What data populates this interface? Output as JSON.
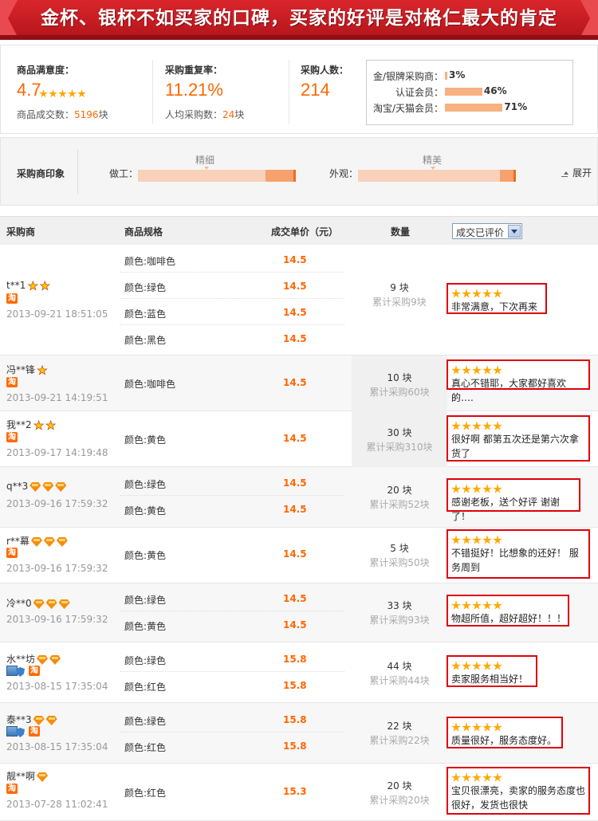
{
  "banner": {
    "title": "金杯、银杯不如买家的口碑，买家的好评是对格仁最大的肯定"
  },
  "summary": {
    "satisfaction": {
      "label": "商品满意度：",
      "value": "4.7",
      "sub_label": "商品成交数：",
      "sub_value": "5196",
      "sub_unit": "块"
    },
    "repurchase": {
      "label": "采购重复率：",
      "value": "11.21%",
      "sub_label": "人均采购数：",
      "sub_value": "24",
      "sub_unit": "块"
    },
    "buyers": {
      "label": "采购人数：",
      "value": "214"
    },
    "breakdown": [
      {
        "label": "金/银牌采购商：",
        "percent": 3,
        "text": "3%"
      },
      {
        "label": "认证会员：",
        "percent": 46,
        "text": "46%"
      },
      {
        "label": "淘宝/天猫会员：",
        "percent": 71,
        "text": "71%"
      }
    ]
  },
  "impression": {
    "label": "采购商印象",
    "items": [
      {
        "key": "做工：",
        "tag": "精细"
      },
      {
        "key": "外观：",
        "tag": "精美"
      }
    ],
    "expand": "展开"
  },
  "table": {
    "headers": {
      "buyer": "采购商",
      "spec": "商品规格",
      "price": "成交单价（元）",
      "qty": "数量"
    },
    "filter": {
      "selected": "成交已评价"
    },
    "rows": [
      {
        "buyer": "t**1",
        "date": "2013-09-21 18:51:05",
        "qty": "9 块",
        "cum": "累计采购9块",
        "review": "非常满意，下次再来",
        "specs": [
          {
            "spec": "颜色:咖啡色",
            "price": "14.5"
          },
          {
            "spec": "颜色:绿色",
            "price": "14.5"
          },
          {
            "spec": "颜色:蓝色",
            "price": "14.5"
          },
          {
            "spec": "颜色:黑色",
            "price": "14.5"
          }
        ]
      },
      {
        "buyer": "冯**锋",
        "date": "2013-09-21 14:19:51",
        "qty": "10 块",
        "cum": "累计采购60块",
        "review": "真心不错耶，大家都好喜欢的….",
        "specs": [
          {
            "spec": "颜色:咖啡色",
            "price": "14.5"
          }
        ]
      },
      {
        "buyer": "我**2",
        "date": "2013-09-17 14:19:48",
        "qty": "30 块",
        "cum": "累计采购310块",
        "review": "很好啊 都第五次还是第六次拿货了",
        "specs": [
          {
            "spec": "颜色:黄色",
            "price": "14.5"
          }
        ]
      },
      {
        "buyer": "q**3",
        "date": "2013-09-16 17:59:32",
        "qty": "20 块",
        "cum": "累计采购52块",
        "review": "感谢老板，送个好评 谢谢了！",
        "specs": [
          {
            "spec": "颜色:绿色",
            "price": "14.5"
          },
          {
            "spec": "颜色:黄色",
            "price": "14.5"
          }
        ]
      },
      {
        "buyer": "r**幕",
        "date": "2013-09-16 17:59:32",
        "qty": "5 块",
        "cum": "累计采购50块",
        "review": "不错挺好！比想象的还好！ 服务周到",
        "specs": [
          {
            "spec": "颜色:黄色",
            "price": "14.5"
          }
        ]
      },
      {
        "buyer": "冷**0",
        "date": "2013-09-16 17:59:32",
        "qty": "33 块",
        "cum": "累计采购93块",
        "review": "物超所值，超好超好！！！",
        "specs": [
          {
            "spec": "颜色:绿色",
            "price": "14.5"
          },
          {
            "spec": "颜色:黄色",
            "price": "14.5"
          }
        ]
      },
      {
        "buyer": "水**坊",
        "date": "2013-08-15 17:35:04",
        "qty": "44 块",
        "cum": "累计采购44块",
        "review": "卖家服务相当好！",
        "specs": [
          {
            "spec": "颜色:绿色",
            "price": "15.8"
          },
          {
            "spec": "颜色:红色",
            "price": "15.8"
          }
        ]
      },
      {
        "buyer": "泰**3",
        "date": "2013-08-15 17:35:04",
        "qty": "22 块",
        "cum": "累计采购22块",
        "review": "质量很好，服务态度好。",
        "specs": [
          {
            "spec": "颜色:绿色",
            "price": "15.8"
          },
          {
            "spec": "颜色:红色",
            "price": "15.8"
          }
        ]
      },
      {
        "buyer": "靓**啊",
        "date": "2013-07-28 11:02:41",
        "qty": "20 块",
        "cum": "累计采购20块",
        "review": "宝贝很漂亮，卖家的服务态度也很好，发货也很快",
        "specs": [
          {
            "spec": "颜色:红色",
            "price": "15.3"
          }
        ]
      }
    ]
  },
  "icons": {
    "taobao_badge": "淘"
  },
  "colors": {
    "accent": "#ff6600",
    "banner": "#c8151d",
    "review_border": "#e0000b"
  }
}
